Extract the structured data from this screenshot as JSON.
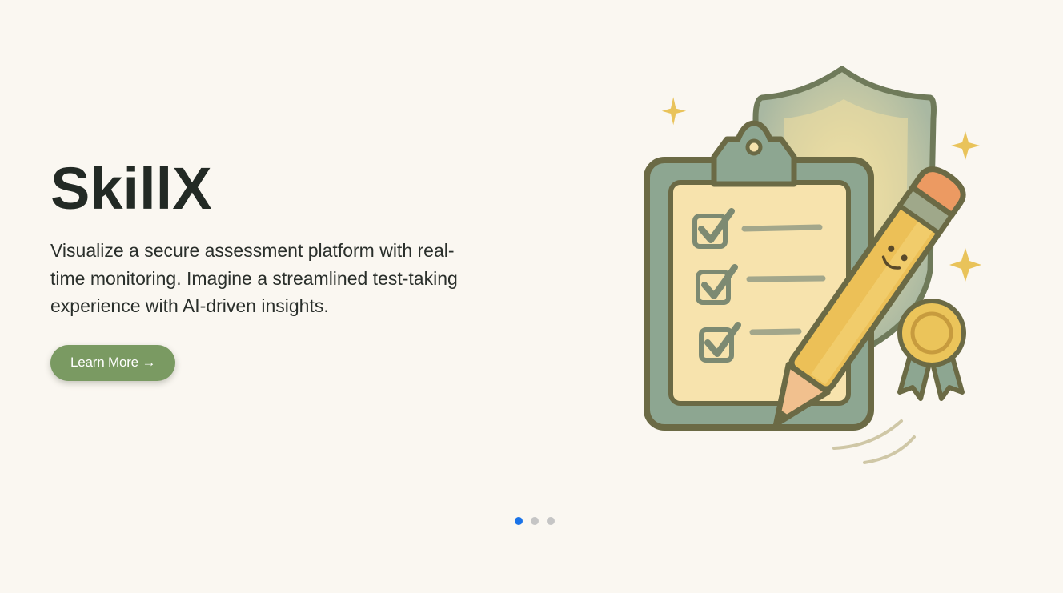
{
  "hero": {
    "title": "SkillX",
    "description": "Visualize a secure assessment platform with real-time monitoring. Imagine a streamlined test-taking experience with AI-driven insights.",
    "cta_label": "Learn More →"
  },
  "illustration": {
    "icons": [
      "shield-icon",
      "clipboard-icon",
      "checkbox-icon",
      "pencil-icon",
      "award-ribbon-icon",
      "sparkle-icon"
    ]
  },
  "carousel": {
    "slide_count": 3,
    "active_index": 0
  },
  "colors": {
    "background": "#faf7f1",
    "title": "#232a25",
    "cta": "#7a9a62",
    "dot_active": "#1a73e8",
    "dot_inactive": "#c5c5c5"
  }
}
